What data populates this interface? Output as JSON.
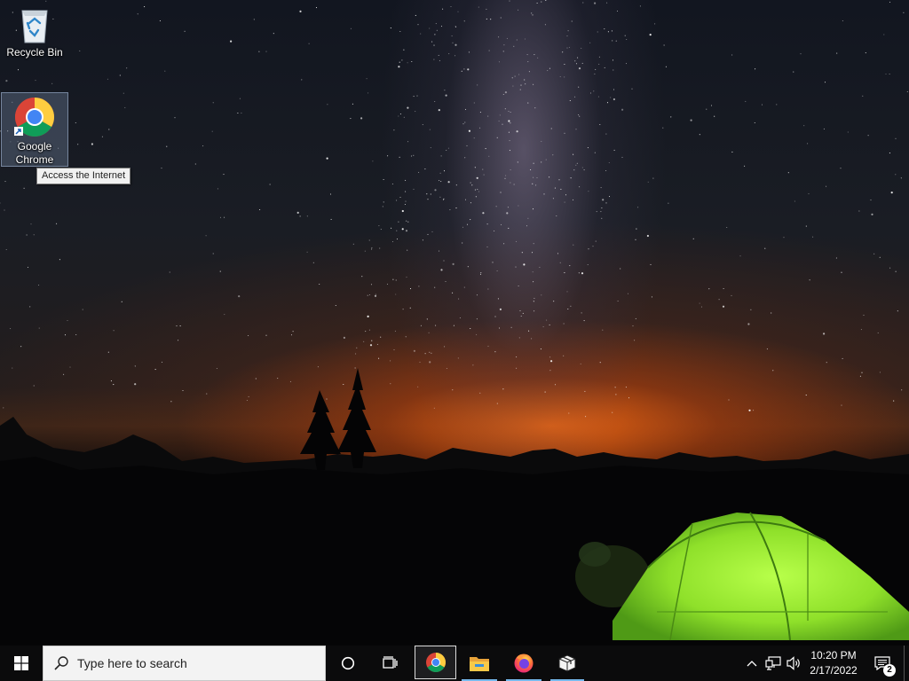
{
  "desktop": {
    "icons": [
      {
        "label": "Recycle Bin",
        "icon": "recycle-bin-icon"
      },
      {
        "label": "Google\nChrome",
        "icon": "chrome-icon",
        "selected": true
      }
    ],
    "tooltip": "Access the Internet"
  },
  "taskbar": {
    "start_icon": "windows-logo-icon",
    "search": {
      "placeholder": "Type here to search",
      "icon": "search-icon"
    },
    "cortana_icon": "cortana-circle-icon",
    "taskview_icon": "task-view-icon",
    "apps": [
      {
        "icon": "chrome-icon",
        "active": true
      },
      {
        "icon": "file-explorer-icon",
        "running": true
      },
      {
        "icon": "firefox-icon",
        "running": true
      },
      {
        "icon": "package-icon",
        "running": true
      }
    ],
    "tray": {
      "icons": [
        "chevron-up-icon",
        "network-icon",
        "volume-icon"
      ],
      "time": "10:20 PM",
      "date": "2/17/2022",
      "notification_count": "2"
    }
  },
  "colors": {
    "accent": "#76b9ed",
    "taskbar_bg": "#0b0b0c",
    "tent_green": "#8fe02a",
    "horizon_orange": "#ff6e14"
  }
}
